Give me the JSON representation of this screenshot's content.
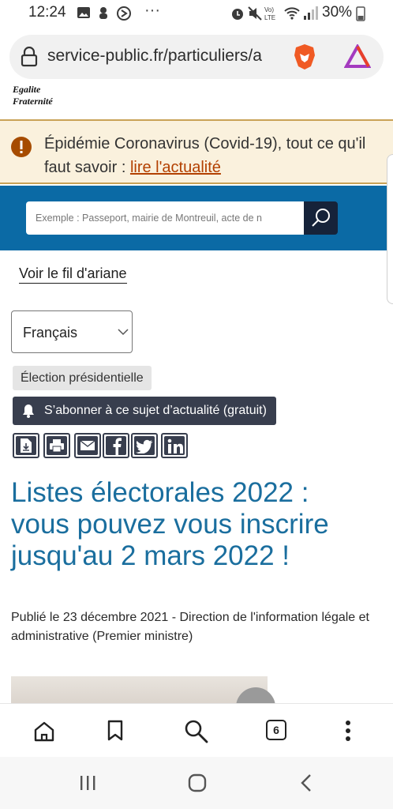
{
  "status_bar": {
    "time": "12:24",
    "more": "···",
    "battery": "30%"
  },
  "browser": {
    "url": "service-public.fr/particuliers/a",
    "tab_count": "6"
  },
  "logo": {
    "line1": "Egalite",
    "line2": "Fraternité"
  },
  "alert": {
    "text": "Épidémie Coronavirus (Covid-19), tout ce qu'il faut savoir : ",
    "link": "lire l'actualité"
  },
  "search": {
    "placeholder": "Exemple : Passeport, mairie de Montreuil, acte de n"
  },
  "breadcrumb": {
    "label": "Voir le fil d'ariane"
  },
  "language": {
    "selected": "Français"
  },
  "article": {
    "tag": "Élection présidentielle",
    "subscribe": "S’abonner à ce sujet d’actualité (gratuit)",
    "title": "Listes électorales 2022 : vous pouvez vous inscrire jusqu'au 2 mars 2022 !",
    "published": "Publié le 23 décembre 2021 - Direction de l'information légale et administrative (Premier ministre)"
  },
  "colors": {
    "band": "#0b6aa5",
    "title": "#1a6e9e",
    "alert_bg": "#faf1dd",
    "alert_link": "#b34000",
    "button_dark": "#383e4e"
  }
}
